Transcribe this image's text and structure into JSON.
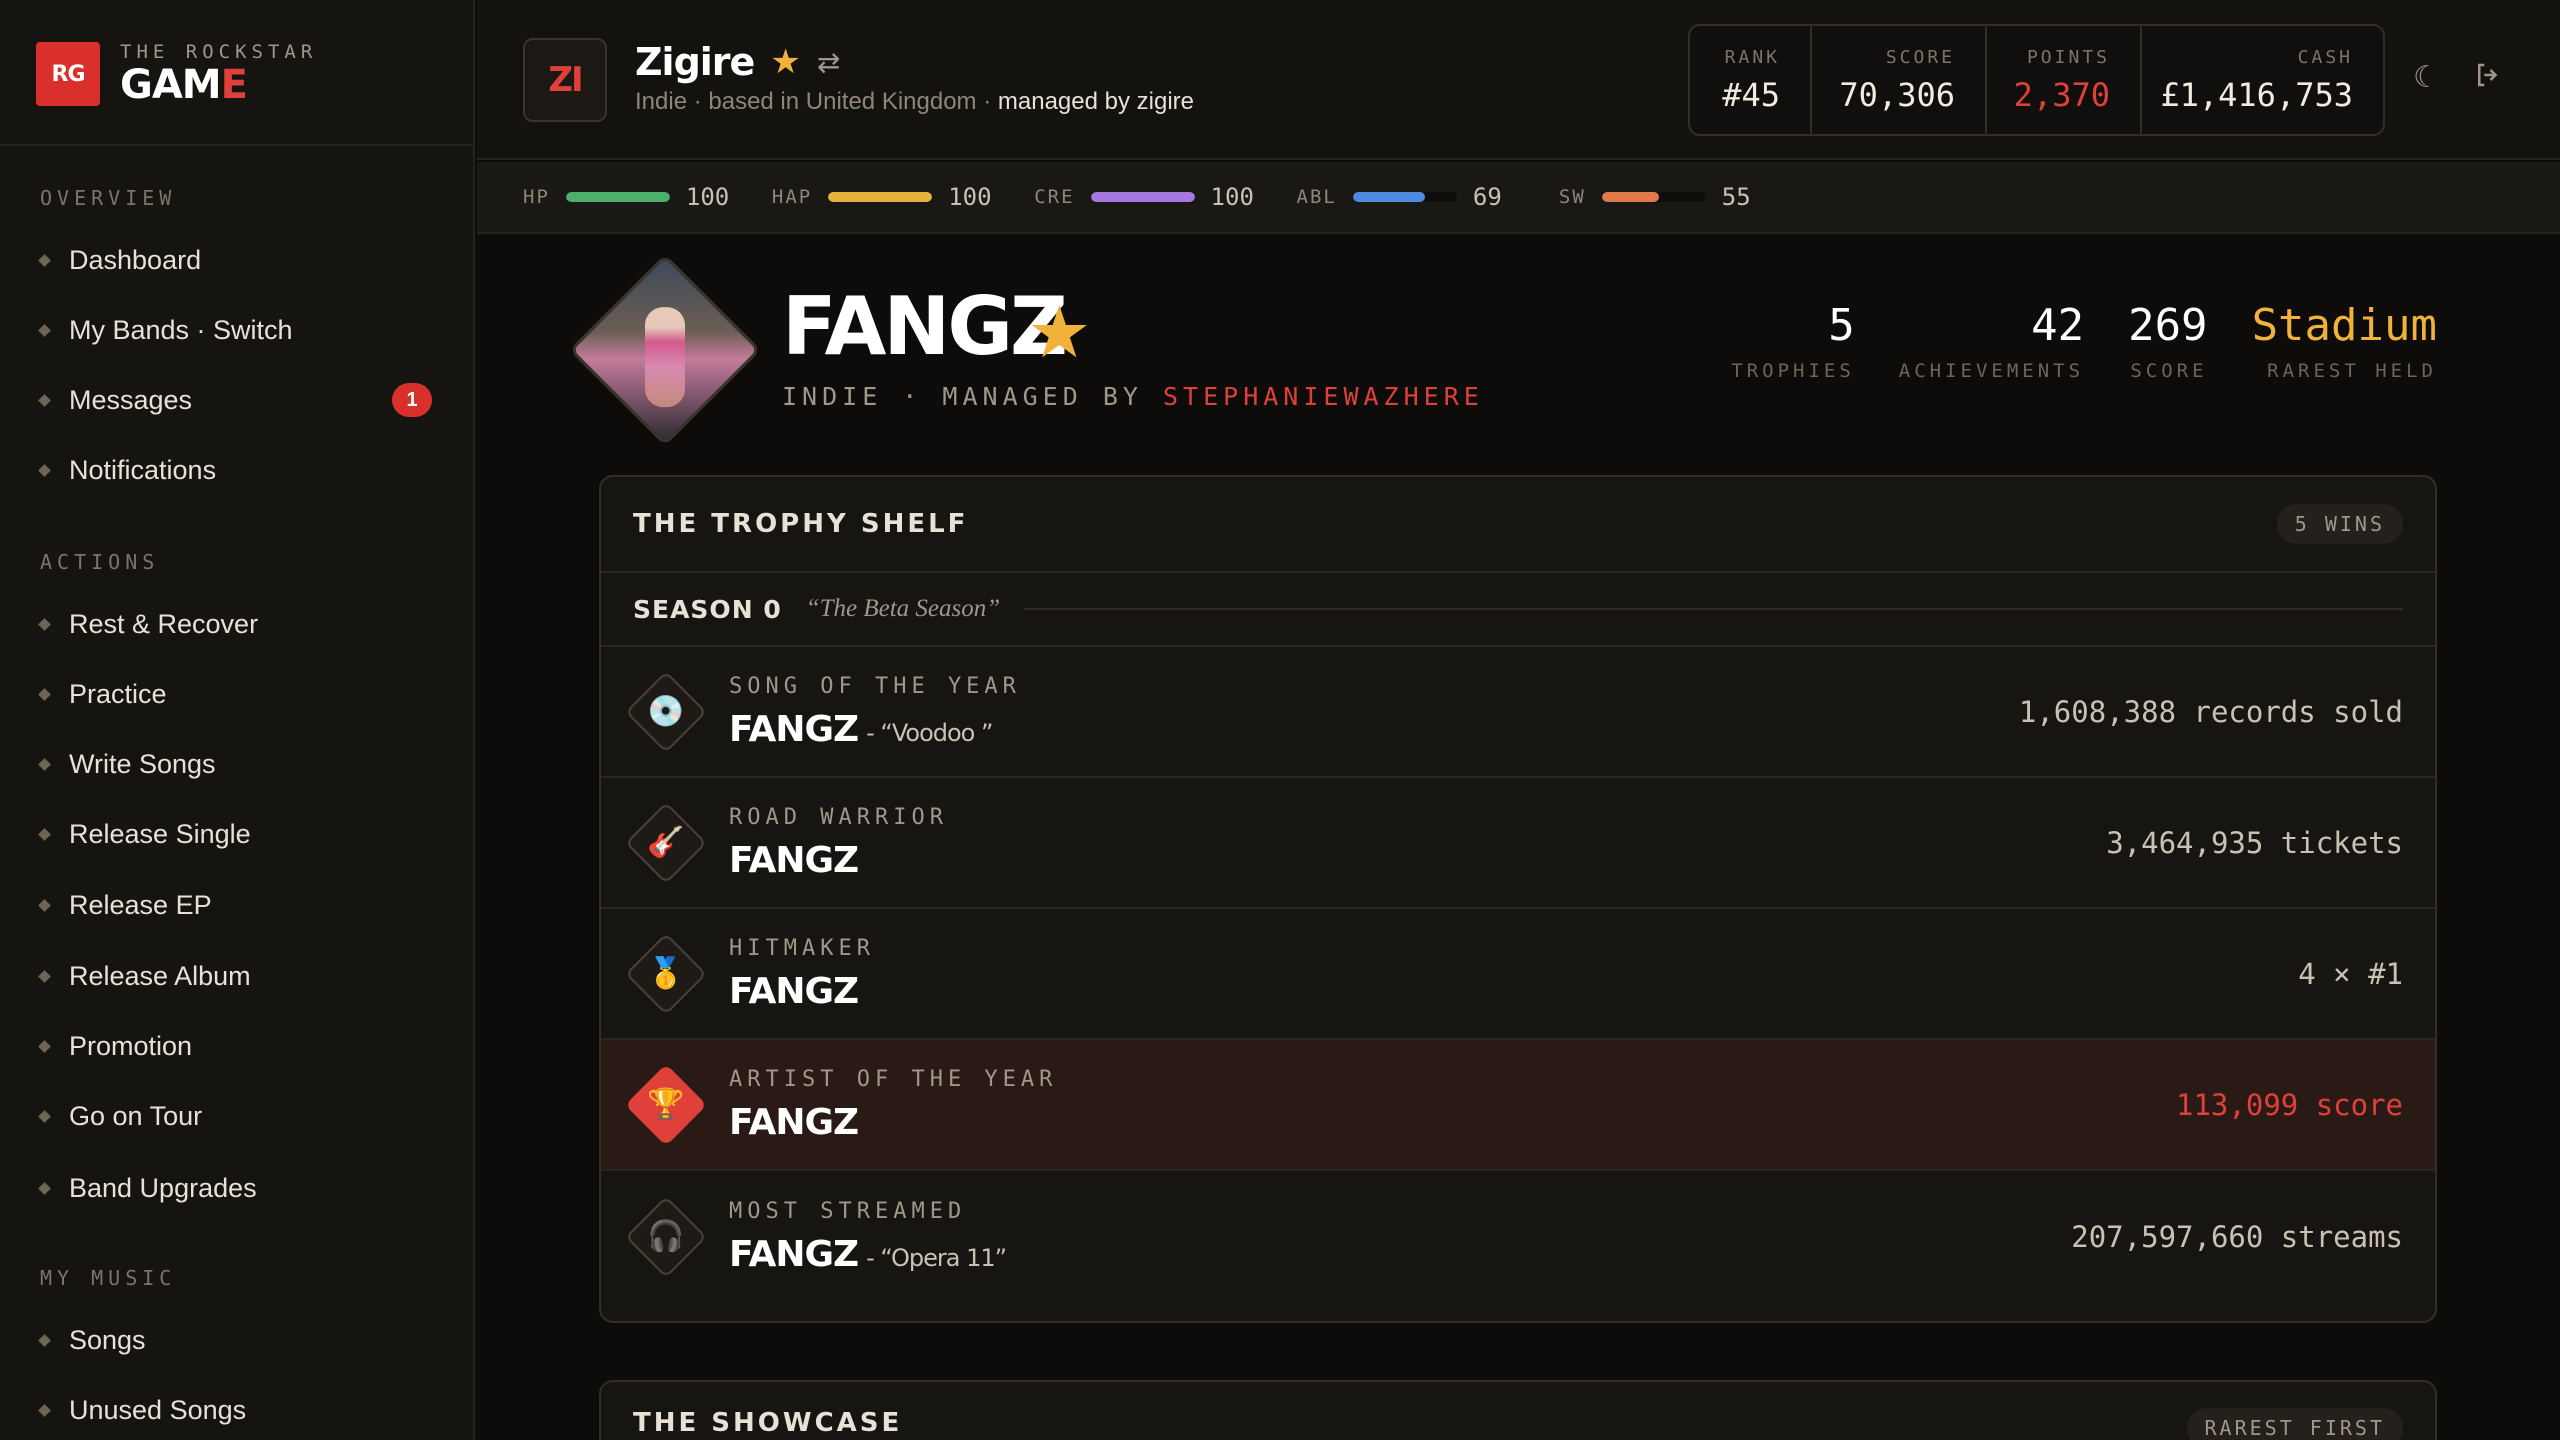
{
  "brand": {
    "logo": "RG",
    "top": "THE ROCKSTAR",
    "bottom_main": "GAM",
    "bottom_accent": "E"
  },
  "sidebar": {
    "sections": [
      {
        "title": "OVERVIEW"
      },
      {
        "title": "ACTIONS"
      },
      {
        "title": "MY MUSIC"
      }
    ],
    "overview": [
      {
        "label": "Dashboard"
      },
      {
        "label": "My Bands · Switch"
      },
      {
        "label": "Messages",
        "badge": "1"
      },
      {
        "label": "Notifications"
      }
    ],
    "actions": [
      {
        "label": "Rest & Recover"
      },
      {
        "label": "Practice"
      },
      {
        "label": "Write Songs"
      },
      {
        "label": "Release Single"
      },
      {
        "label": "Release EP"
      },
      {
        "label": "Release Album"
      },
      {
        "label": "Promotion"
      },
      {
        "label": "Go on Tour"
      },
      {
        "label": "Band Upgrades"
      }
    ],
    "music": [
      {
        "label": "Songs"
      },
      {
        "label": "Unused Songs"
      }
    ]
  },
  "header": {
    "avatar": "ZI",
    "band_name": "Zigire",
    "sub_prefix": "Indie · based in United Kingdom · ",
    "managed_by": "managed by zigire",
    "stats": [
      {
        "label": "RANK",
        "value": "#45"
      },
      {
        "label": "SCORE",
        "value": "70,306"
      },
      {
        "label": "POINTS",
        "value": "2,370"
      },
      {
        "label": "CASH",
        "value": "£1,416,753"
      }
    ],
    "icons": {
      "theme": "moon-icon",
      "logout": "logout-icon"
    }
  },
  "vitals": [
    {
      "label": "HP",
      "value": "100",
      "level": 1.0,
      "color": "#4caf6a"
    },
    {
      "label": "HAP",
      "value": "100",
      "level": 1.0,
      "color": "#e8b23a"
    },
    {
      "label": "CRE",
      "value": "100",
      "level": 1.0,
      "color": "#a678e0"
    },
    {
      "label": "ABL",
      "value": "69",
      "level": 0.69,
      "color": "#4f8be0"
    },
    {
      "label": "SW",
      "value": "55",
      "level": 0.55,
      "color": "#e07a48"
    }
  ],
  "profile": {
    "name": "FANGZ",
    "genre": "INDIE · MANAGED BY ",
    "manager": "STEPHANIEWAZHERE",
    "stats": [
      {
        "value": "5",
        "label": "TROPHIES"
      },
      {
        "value": "42",
        "label": "ACHIEVEMENTS"
      },
      {
        "value": "269",
        "label": "SCORE"
      },
      {
        "value": "Stadium",
        "label": "RAREST HELD"
      }
    ]
  },
  "trophy_shelf": {
    "title": "THE TROPHY SHELF",
    "chip": "5 WINS",
    "season": {
      "name": "SEASON 0",
      "tag": "“The Beta Season”"
    },
    "trophies": [
      {
        "icon": "disc-icon",
        "glyph": "💿",
        "category": "SONG OF THE YEAR",
        "artist": "FANGZ",
        "work": "- “Voodoo ”",
        "stat": "1,608,388 records sold"
      },
      {
        "icon": "guitar-icon",
        "glyph": "🎸",
        "category": "ROAD WARRIOR",
        "artist": "FANGZ",
        "work": "",
        "stat": "3,464,935 tickets"
      },
      {
        "icon": "medal-icon",
        "glyph": "🥇",
        "category": "HITMAKER",
        "artist": "FANGZ",
        "work": "",
        "stat": "4 × #1"
      },
      {
        "icon": "trophy-icon",
        "glyph": "🏆",
        "category": "ARTIST OF THE YEAR",
        "artist": "FANGZ",
        "work": "",
        "stat": "113,099 score"
      },
      {
        "icon": "headphones-icon",
        "glyph": "🎧",
        "category": "MOST STREAMED",
        "artist": "FANGZ",
        "work": "- “Opera 11”",
        "stat": "207,597,660 streams"
      }
    ]
  },
  "showcase": {
    "title": "THE SHOWCASE",
    "chip": "RAREST FIRST"
  }
}
